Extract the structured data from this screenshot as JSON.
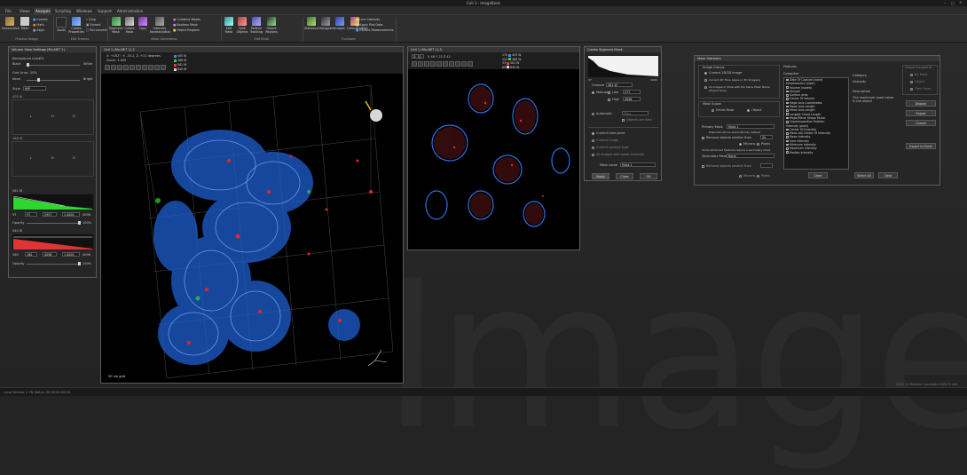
{
  "app": {
    "window_title": "Cell 1 - ImageBook"
  },
  "tabs": [
    "File",
    "Views",
    "Analysis",
    "Scripting",
    "Windows",
    "Support",
    "Administration"
  ],
  "active_tab": "Analysis",
  "ribbon": {
    "buttons": {
      "deconvolve": "Deconvolve",
      "filter": "Filter",
      "correct": "Correct",
      "math": "Math",
      "align": "Align",
      "fluorescence_estimation": "Spots",
      "create_properties": "Create Properties",
      "crop": "Crop",
      "extract": "Extract",
      "roi_convert": "Roi convert",
      "segment_mask": "Segment Mask",
      "create_mask": "Create Mask",
      "intensity_normalization": "Intensity Normalization",
      "copy": "Copy",
      "combine_masks": "Combine Masks",
      "boolean_mask": "Boolean Mask",
      "object_regions": "Object Regions",
      "edit_mask": "Edit Mask",
      "split_objects": "Split Objects",
      "particle_tracking": "Particle Tracking",
      "statistics": "Statistics",
      "histogram": "Histogram",
      "images": "Images",
      "colocalization": "Colocalization",
      "extract_measurements": "Extract Measurements",
      "line_intensity": "Line Intensity",
      "apply_plot_data": "Apply Plot Data",
      "time_plot": "Time Plot"
    },
    "groups": {
      "process_image": "Process Image",
      "edit_frames": "Edit Frames",
      "mask_generation": "Mask Generation",
      "edit_mask": "Edit Mask",
      "evaluate": "Evaluate"
    }
  },
  "volume_settings": {
    "title": "Volume View Settings (Mx-NET 1)",
    "background_color_label": "Background Color",
    "background_color_value": "0%",
    "black": "Black",
    "white": "White",
    "grid_lines_label": "Grid Lines",
    "grid_lines_value": "20%",
    "none": "None",
    "bright": "Bright",
    "style_label": "Style",
    "style_value": "MIP",
    "ch1_name": "405 W",
    "ch2_name": "488 W",
    "ch3_name": "561 W",
    "ch4_name": "640 W",
    "low_label": "L",
    "mid_label": "H",
    "high_label": "G",
    "ch3_low": "97",
    "ch3_low2": "97",
    "ch3_mid": "2957",
    "ch3_g": "1.0000",
    "ch3_high": "4096",
    "ch4_low": "160",
    "ch4_low2": "160",
    "ch4_mid": "4096",
    "ch4_g": "1.0000",
    "ch4_high": "4096",
    "opacity_label": "Opacity",
    "opacity_value_3": "100%",
    "opacity_value_4": "100%"
  },
  "volume_view": {
    "title": "Cell 1 (Mx-NET 1)-2",
    "info1": "X: +162°, Y: -35.2, Z: +21 degrees",
    "info2": "Zoom: 1.000",
    "channels": [
      "405 W",
      "488 W",
      "561 W",
      "640 W"
    ],
    "channel_colors": [
      "#3f7fff",
      "#2fd62f",
      "#ff3535",
      "#d8d8d8"
    ],
    "scale_label": "50 um grid"
  },
  "slice_view": {
    "title": "Cell 1 (Mx-NET 1)-3",
    "z": "Z: 70",
    "coords": "X 46 Y 22 Z 42",
    "channel_values": [
      {
        "value": "170",
        "name": "405 W"
      },
      {
        "value": "212",
        "name": "488 W"
      },
      {
        "value": "33",
        "name": "561 W"
      },
      {
        "value": "89",
        "name": "640 W"
      }
    ]
  },
  "segment_mask": {
    "title": "Create Segment Mask",
    "hist_min": "97",
    "hist_max": "4096",
    "channel_label": "Channel",
    "channel_value": "561 W",
    "manual": "Manual",
    "low_label": "Low",
    "low_value": "577",
    "high_label": "High",
    "high_value": "4096",
    "automatic": "Automatic",
    "automatic_value": "Otsu",
    "objects_are_dark": "Objects are dark",
    "current_time_point": "Current time point",
    "current_image": "Current image",
    "current_capture_type": "Current capture type",
    "all_images": "All images with same channels",
    "mask_name_label": "Mask name",
    "mask_name_value": "Mask 1",
    "apply": "Apply",
    "close": "Close",
    "ok": "OK"
  },
  "mask_statistics": {
    "title": "Mask Statistics",
    "image_groups_label": "Image Groups",
    "current_2d3d": "Current 2D/3D Image",
    "current_2d_time": "Current 2D Time Lapse or 4D Image(s)",
    "all_images_slide": "All images in Slide with the Same Mask Name (Export Only)",
    "mask_scope_label": "Mask Scope",
    "entire_mask": "Entire Mask",
    "object": "Object",
    "primary_mask_label": "Primary Mask",
    "primary_mask_value": "Mask 1",
    "ellipsoids_note": "Ellipsoids will be automatically defined",
    "remove_smaller": "Remove objects smaller than",
    "remove_smaller_value": "20",
    "microns": "Microns",
    "pixels": "Pixels",
    "advanced_note": "Some advanced features require a secondary mask",
    "secondary_mask_label": "Secondary Mask",
    "secondary_mask_value": "None",
    "remove_smaller2": "Remove objects smaller than",
    "microns2": "Microns",
    "pixels2": "Pixels",
    "features_label": "Features",
    "computer_label": "Computer",
    "feature_items": [
      "Date Of Capture (none)",
      "Morphometry (pixel)",
      "Volume (voxels)",
      "Volume",
      "Surface Area",
      "Center Of Volume",
      "Major Axis Coordinates",
      "Major Axis Length",
      "Minor Axis Length",
      "Longest Chord Length",
      "Major/Minor Shape Factor",
      "Superimposition Position",
      "Intensity (pixel)",
      "Center Of Intensity",
      "Mean Adj Center Of Intensity",
      "Mean Intensity",
      "Sum Intensity",
      "Minimum Intensity",
      "Maximum Intensity",
      "Median Intensity"
    ],
    "category_label": "Category",
    "category_value": "Intensity",
    "description_label": "Description",
    "description_value": "The maximum voxel value in the object",
    "output_grouped_label": "Output Grouped By",
    "by_mask": "By Mask",
    "by_object": "Object",
    "by_time_point": "Time Point",
    "display": "Display",
    "export": "Export",
    "cancel": "Cancel",
    "export_excel": "Export to Excel",
    "clear": "Clear",
    "select_all": "Select All",
    "clear2": "Clear"
  },
  "status": {
    "left": "Local  Service: 2 FN  Status: 00:00:00:00:00",
    "right": "2023 3.0 Release Candidate 430279 x64"
  },
  "watermark": "ImageBook"
}
